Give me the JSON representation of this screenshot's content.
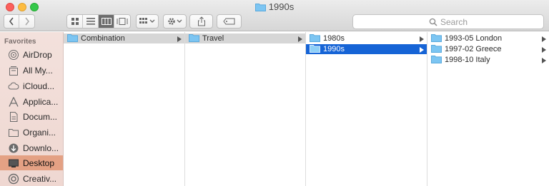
{
  "window": {
    "title": "1990s"
  },
  "toolbar": {
    "search_placeholder": "Search"
  },
  "sidebar": {
    "heading": "Favorites",
    "items": [
      {
        "label": "AirDrop",
        "icon": "airdrop-icon"
      },
      {
        "label": "All My...",
        "icon": "all-my-files-icon"
      },
      {
        "label": "iCloud...",
        "icon": "icloud-icon"
      },
      {
        "label": "Applica...",
        "icon": "applications-icon"
      },
      {
        "label": "Docum...",
        "icon": "documents-icon"
      },
      {
        "label": "Organi...",
        "icon": "folder-icon"
      },
      {
        "label": "Downlo...",
        "icon": "downloads-icon"
      },
      {
        "label": "Desktop",
        "icon": "desktop-icon",
        "selected": true
      },
      {
        "label": "Creativ...",
        "icon": "creative-cloud-icon"
      }
    ]
  },
  "columns": [
    {
      "items": [
        {
          "label": "Combination",
          "state": "path",
          "has_children": true
        }
      ]
    },
    {
      "items": [
        {
          "label": "Travel",
          "state": "path",
          "has_children": true
        }
      ]
    },
    {
      "items": [
        {
          "label": "1980s",
          "state": "normal",
          "has_children": true
        },
        {
          "label": "1990s",
          "state": "selected",
          "has_children": true
        }
      ]
    },
    {
      "items": [
        {
          "label": "1993-05 London",
          "state": "normal",
          "has_children": true
        },
        {
          "label": "1997-02 Greece",
          "state": "normal",
          "has_children": true
        },
        {
          "label": "1998-10 Italy",
          "state": "normal",
          "has_children": true
        }
      ]
    }
  ],
  "colors": {
    "selection": "#1664d6",
    "sidebar_selected": "#e4a184",
    "folder": "#7cc5f2"
  }
}
